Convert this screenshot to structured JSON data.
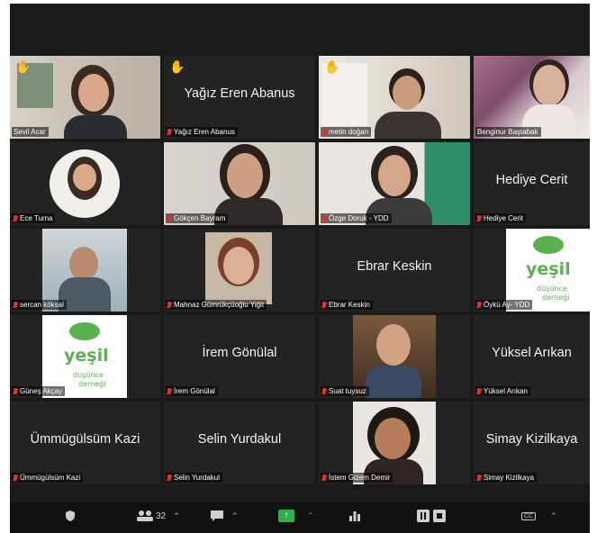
{
  "participants": [
    {
      "name": "Sevil Acar",
      "big_name": "",
      "video": true,
      "hand": true,
      "muted": false,
      "active": false
    },
    {
      "name": "Yağız Eren Abanus",
      "big_name": "Yağız Eren Abanus",
      "video": false,
      "hand": true,
      "muted": true,
      "active": false
    },
    {
      "name": "metin doğan",
      "big_name": "",
      "video": true,
      "hand": true,
      "muted": true,
      "active": false
    },
    {
      "name": "Benginur Baştabak",
      "big_name": "",
      "video": true,
      "hand": false,
      "muted": false,
      "active": true
    },
    {
      "name": "Ece Turna",
      "big_name": "",
      "video": true,
      "hand": false,
      "muted": true,
      "active": false
    },
    {
      "name": "Gökçen Bayram",
      "big_name": "",
      "video": true,
      "hand": false,
      "muted": true,
      "active": false
    },
    {
      "name": "Özge Doruk - YDD",
      "big_name": "",
      "video": true,
      "hand": false,
      "muted": true,
      "active": false
    },
    {
      "name": "Hediye Cerit",
      "big_name": "Hediye Cerit",
      "video": false,
      "hand": false,
      "muted": true,
      "active": false
    },
    {
      "name": "sercan köksal",
      "big_name": "",
      "video": true,
      "hand": false,
      "muted": true,
      "active": false
    },
    {
      "name": "Mahnaz Gümrükçüoğlu Yiğit",
      "big_name": "",
      "video": true,
      "hand": false,
      "muted": true,
      "active": false
    },
    {
      "name": "Ebrar Keskin",
      "big_name": "Ebrar Keskin",
      "video": false,
      "hand": false,
      "muted": true,
      "active": false
    },
    {
      "name": "Öykü Ay- YDD",
      "big_name": "",
      "video": true,
      "hand": false,
      "muted": true,
      "active": false
    },
    {
      "name": "Güneş Akçay",
      "big_name": "",
      "video": true,
      "hand": false,
      "muted": true,
      "active": false
    },
    {
      "name": "İrem Gönülal",
      "big_name": "İrem Gönülal",
      "video": false,
      "hand": false,
      "muted": true,
      "active": false
    },
    {
      "name": "Suat tuysuz",
      "big_name": "",
      "video": true,
      "hand": false,
      "muted": true,
      "active": false
    },
    {
      "name": "Yüksel Arıkan",
      "big_name": "Yüksel Arıkan",
      "video": false,
      "hand": false,
      "muted": true,
      "active": false
    },
    {
      "name": "Ümmügülsüm Kazi",
      "big_name": "Ümmügülsüm Kazi",
      "video": false,
      "hand": false,
      "muted": true,
      "active": false
    },
    {
      "name": "Selin Yurdakul",
      "big_name": "Selin Yurdakul",
      "video": false,
      "hand": false,
      "muted": true,
      "active": false
    },
    {
      "name": "İstem Gizem Demir",
      "big_name": "",
      "video": true,
      "hand": false,
      "muted": true,
      "active": false
    },
    {
      "name": "Simay Kizilkaya",
      "big_name": "Simay Kizilkaya",
      "video": false,
      "hand": false,
      "muted": true,
      "active": false
    }
  ],
  "logo": {
    "word": "yeşil",
    "sub1": "düşünce",
    "sub2": "derneği"
  },
  "toolbar": {
    "participants_count": "32",
    "colors": {
      "share": "#2bb24c",
      "active_border": "#57c24a",
      "muted": "#e0312b"
    }
  }
}
